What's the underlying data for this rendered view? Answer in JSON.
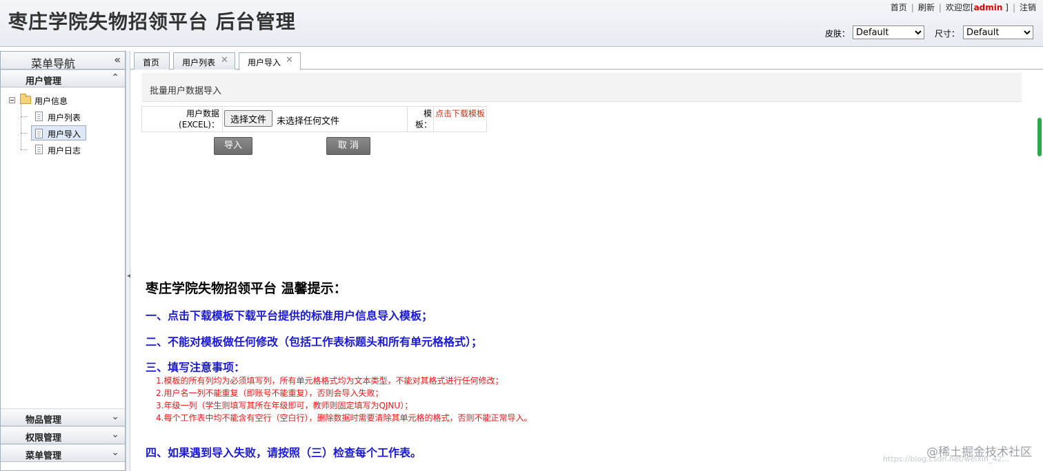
{
  "header": {
    "title": "枣庄学院失物招领平台 后台管理",
    "links": [
      "首页",
      "刷新"
    ],
    "welcome_prefix": "欢迎您[",
    "admin_name": "admin",
    "welcome_suffix": "]",
    "logout": "注销",
    "skin_label": "皮肤：",
    "skin_value": "Default",
    "size_label": "尺寸：",
    "size_value": "Default"
  },
  "sidebar": {
    "title": "菜单导航",
    "collapse_icon": "«",
    "user_panel": "用户管理",
    "tree": {
      "folder": "用户信息",
      "items": [
        "用户列表",
        "用户导入",
        "用户日志"
      ]
    },
    "panels": [
      "物品管理",
      "权限管理",
      "菜单管理"
    ]
  },
  "tabs": [
    {
      "label": "首页"
    },
    {
      "label": "用户列表"
    },
    {
      "label": "用户导入"
    }
  ],
  "form": {
    "section_title": "批量用户数据导入",
    "label_line1": "用户数据",
    "label_line2": "(EXCEL)：",
    "file_button": "选择文件",
    "file_status": "未选择任何文件",
    "template_label_1": "模",
    "template_label_2": "板：",
    "template_link": "点击下载模板",
    "import_button": "导入",
    "cancel_button": "取 消"
  },
  "tips": {
    "title": "枣庄学院失物招领平台 温馨提示：",
    "point1": "一、点击下载模板下载平台提供的标准用户信息导入模板；",
    "point2": "二、不能对模板做任何修改（包括工作表标题头和所有单元格格式）；",
    "point3": "三、填写注意事项：",
    "sub1": "1.模板的所有列均为必须填写列，所有单元格格式均为文本类型，不能对其格式进行任何修改；",
    "sub2": "2.用户名一列不能重复（即账号不能重复），否则会导入失败；",
    "sub3": "3.年级一列（学生则填写其所在年级即可，教师则固定填写为QJNU）；",
    "sub4": "4.每个工作表中均不能含有空行（空白行），删除数据时需要清除其单元格的格式，否则不能正常导入。",
    "point4": "四、如果遇到导入失败，请按照（三）检查每个工作表。"
  },
  "watermark": "@稀土掘金技术社区",
  "watermark_url": "https://blog.csdn.net/weixin_42..."
}
